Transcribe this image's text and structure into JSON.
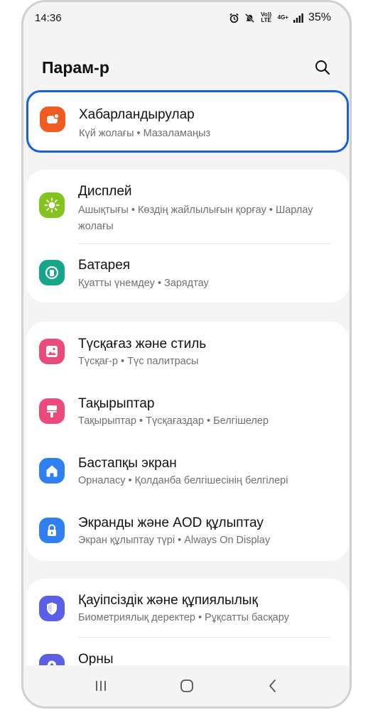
{
  "status": {
    "time": "14:36",
    "volte": "Vo)) LTE",
    "network": "4G+",
    "battery": "35%"
  },
  "header": {
    "title": "Парам-р"
  },
  "sections": [
    {
      "items": [
        {
          "title": "Хабарландырулар",
          "subtitle": "Күй жолағы • Мазаламаңыз",
          "icon": "notifications-icon",
          "color": "#f05a23"
        }
      ]
    },
    {
      "items": [
        {
          "title": "Дисплей",
          "subtitle": "Ашықтығы • Көздің жайлылығын қорғау • Шарлау жолағы",
          "icon": "display-sun-icon",
          "color": "#83c41f"
        },
        {
          "title": "Батарея",
          "subtitle": "Қуатты үнемдеу • Зарядтау",
          "icon": "battery-icon",
          "color": "#14a58a"
        }
      ]
    },
    {
      "items": [
        {
          "title": "Түсқағаз және стиль",
          "subtitle": "Түсқағ-р • Түс палитрасы",
          "icon": "wallpaper-icon",
          "color": "#ea4a7c"
        },
        {
          "title": "Тақырыптар",
          "subtitle": "Тақырыптар • Түсқағаздар • Белгішелер",
          "icon": "themes-icon",
          "color": "#ea4a7c"
        },
        {
          "title": "Бастапқы экран",
          "subtitle": "Орналасу • Қолданба белгішесінің белгілері",
          "icon": "home-icon",
          "color": "#2f7ff2"
        },
        {
          "title": "Экранды және AOD құлыптау",
          "subtitle": "Экран құлыптау түрі • Always On Display",
          "icon": "lock-icon",
          "color": "#2f7ff2"
        }
      ]
    },
    {
      "items": [
        {
          "title": "Қауіпсіздік және құпиялылық",
          "subtitle": "Биометриялық деректер • Рұқсатты басқару",
          "icon": "shield-icon",
          "color": "#5b5fe5"
        },
        {
          "title": "Орны",
          "subtitle": "",
          "icon": "location-icon",
          "color": "#5b5fe5"
        }
      ]
    }
  ]
}
